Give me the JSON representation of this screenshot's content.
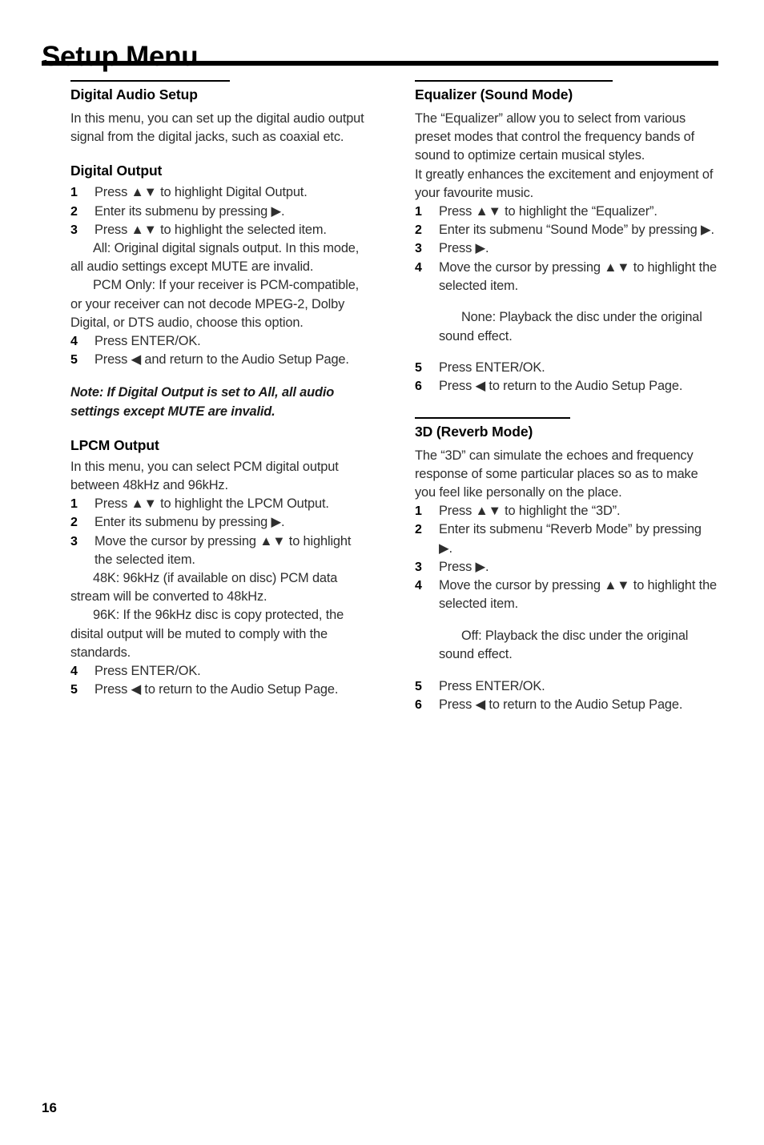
{
  "document": {
    "title": "Setup Menu",
    "page_number": "16"
  },
  "left_column": {
    "section": {
      "heading": "Digital Audio Setup",
      "intro": "In this menu, you can set up the digital audio output signal from the digital jacks, such as coaxial etc."
    },
    "digital_output": {
      "heading": "Digital Output",
      "steps": [
        {
          "num": "1",
          "text": "Press ▲▼ to highlight Digital Output."
        },
        {
          "num": "2",
          "text": "Enter its submenu by pressing ▶."
        },
        {
          "num": "3",
          "text": "Press ▲▼ to highlight the selected item."
        }
      ],
      "options": [
        "All: Original digital signals output. In this mode, all audio settings except MUTE are invalid.",
        "PCM Only: If your receiver is PCM-compatible, or your receiver can not decode MPEG-2, Dolby Digital, or DTS audio, choose this option."
      ],
      "steps_after": [
        {
          "num": "4",
          "text": "Press ENTER/OK."
        },
        {
          "num": "5",
          "text": "Press ◀ and return to the Audio Setup Page."
        }
      ],
      "note": "Note: If Digital Output is set to All, all audio settings except MUTE are invalid."
    },
    "lpcm_output": {
      "heading": "LPCM Output",
      "intro": "In this menu, you can select PCM digital output between 48kHz and 96kHz.",
      "steps": [
        {
          "num": "1",
          "text": "Press ▲▼ to highlight the LPCM Output."
        },
        {
          "num": "2",
          "text": "Enter its submenu by pressing ▶."
        },
        {
          "num": "3",
          "text": "Move the cursor by pressing ▲▼ to highlight the selected item."
        }
      ],
      "options": [
        "48K: 96kHz (if available on disc) PCM data stream will be converted to 48kHz.",
        "96K: If the 96kHz disc is copy protected, the disital output will be muted to comply with the standards."
      ],
      "steps_after": [
        {
          "num": "4",
          "text": "Press ENTER/OK."
        },
        {
          "num": "5",
          "text": "Press ◀ to return to the Audio Setup Page."
        }
      ]
    }
  },
  "right_column": {
    "equalizer": {
      "heading": "Equalizer (Sound Mode)",
      "intro_1": "The “Equalizer” allow you to select from various preset modes that control the frequency bands of sound to optimize certain musical styles.",
      "intro_2": "It greatly enhances the excitement and enjoyment of your favourite music.",
      "steps": [
        {
          "num": "1",
          "text": "Press ▲▼ to highlight the “Equalizer”."
        },
        {
          "num": "2",
          "text": "Enter its submenu “Sound Mode” by pressing ▶."
        },
        {
          "num": "3",
          "text": "Press ▶."
        },
        {
          "num": "4",
          "text": "Move the cursor by pressing ▲▼ to highlight the selected item."
        }
      ],
      "options": [
        "None: Playback the disc under the original sound effect."
      ],
      "steps_after": [
        {
          "num": "5",
          "text": "Press ENTER/OK."
        },
        {
          "num": "6",
          "text": "Press ◀ to return to the Audio Setup Page."
        }
      ]
    },
    "reverb": {
      "heading": "3D (Reverb Mode)",
      "intro": "The “3D” can simulate the echoes and frequency response of some particular places so as to make you feel like personally on the place.",
      "steps": [
        {
          "num": "1",
          "text": "Press ▲▼ to highlight the “3D”."
        },
        {
          "num": "2",
          "text": "Enter its submenu “Reverb Mode” by pressing ▶."
        },
        {
          "num": "3",
          "text": "Press ▶."
        },
        {
          "num": "4",
          "text": "Move the cursor by pressing ▲▼ to highlight the selected item."
        }
      ],
      "options": [
        "Off: Playback the disc under the original sound effect."
      ],
      "steps_after": [
        {
          "num": "5",
          "text": "Press ENTER/OK."
        },
        {
          "num": "6",
          "text": "Press ◀ to return to the Audio Setup Page."
        }
      ]
    }
  }
}
